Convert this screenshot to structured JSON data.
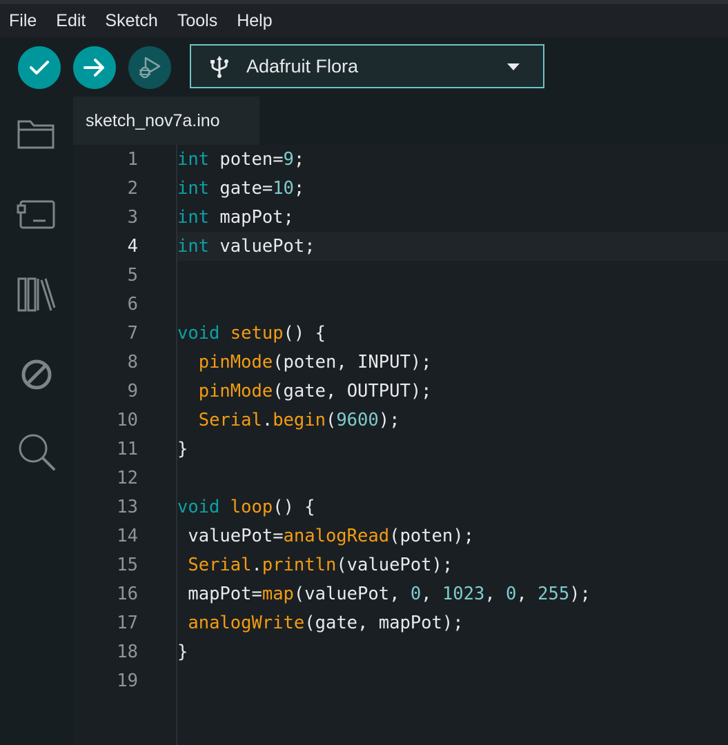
{
  "menu": {
    "items": [
      "File",
      "Edit",
      "Sketch",
      "Tools",
      "Help"
    ]
  },
  "toolbar": {
    "board_name": "Adafruit Flora"
  },
  "tabs": [
    {
      "label": "sketch_nov7a.ino"
    }
  ],
  "sidebar": {
    "icons": [
      "sketchbook-icon",
      "boards-manager-icon",
      "library-manager-icon",
      "debug-icon",
      "search-icon"
    ]
  },
  "editor": {
    "current_line": 4,
    "lines": [
      {
        "num": "1",
        "text": "int poten=9;"
      },
      {
        "num": "2",
        "text": "int gate=10;"
      },
      {
        "num": "3",
        "text": "int mapPot;"
      },
      {
        "num": "4",
        "text": "int valuePot;"
      },
      {
        "num": "5",
        "text": ""
      },
      {
        "num": "6",
        "text": ""
      },
      {
        "num": "7",
        "text": "void setup() {"
      },
      {
        "num": "8",
        "text": "  pinMode(poten, INPUT);"
      },
      {
        "num": "9",
        "text": "  pinMode(gate, OUTPUT);"
      },
      {
        "num": "10",
        "text": "  Serial.begin(9600);"
      },
      {
        "num": "11",
        "text": "}"
      },
      {
        "num": "12",
        "text": ""
      },
      {
        "num": "13",
        "text": "void loop() {"
      },
      {
        "num": "14",
        "text": " valuePot=analogRead(poten);"
      },
      {
        "num": "15",
        "text": " Serial.println(valuePot);"
      },
      {
        "num": "16",
        "text": " mapPot=map(valuePot, 0, 1023, 0, 255);"
      },
      {
        "num": "17",
        "text": " analogWrite(gate, mapPot);"
      },
      {
        "num": "18",
        "text": "}"
      },
      {
        "num": "19",
        "text": ""
      }
    ]
  },
  "colors": {
    "accent": "#00979c",
    "keyword": "#0ca1a6",
    "function": "#f39c12",
    "number": "#7fcbcd",
    "text": "#e8eaec"
  }
}
